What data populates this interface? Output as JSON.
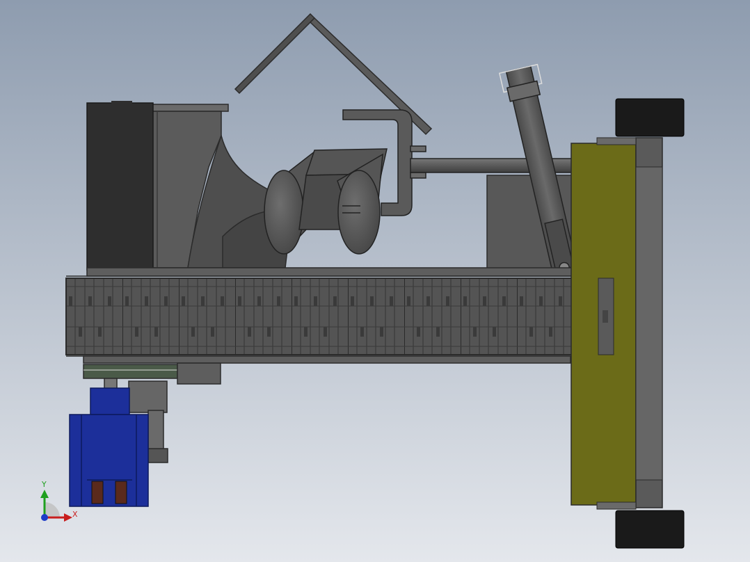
{
  "viewport": {
    "background_top": "#8e9caf",
    "background_bottom": "#e4e7ec"
  },
  "triad": {
    "y_label": "Y",
    "x_label": "X",
    "y_color": "#1fa01f",
    "x_color": "#c81e1e",
    "z_color": "#1e3cc8"
  },
  "colors": {
    "edge": "#2b2b2b",
    "steel_dark": "#3f3f3f",
    "steel_mid": "#5a5a5a",
    "steel_light": "#7b7b7b",
    "black_box": "#2e2e2e",
    "tire": "#1a1a1a",
    "olive_plate": "#6b6b18",
    "motor_blue": "#1c2f9a",
    "terminal_brown": "#5a2a1c",
    "green_plate": "#4a5a48"
  }
}
